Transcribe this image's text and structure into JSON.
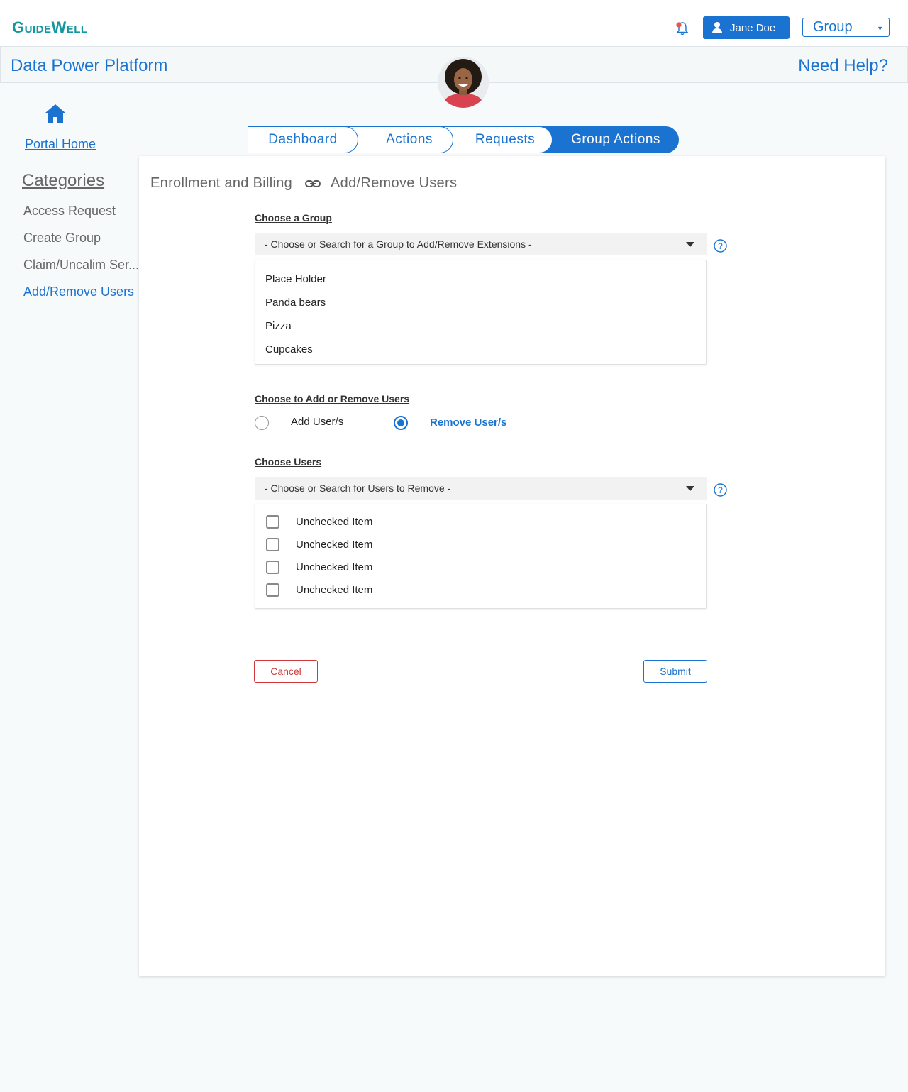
{
  "header": {
    "logo": "GuideWell",
    "user_name": "Jane Doe",
    "group_select": "Group"
  },
  "platform": {
    "title": "Data Power Platform",
    "help": "Need Help?"
  },
  "sidebar": {
    "home_label": "Portal Home",
    "categories_title": "Categories",
    "items": [
      {
        "label": "Access Request"
      },
      {
        "label": "Create Group"
      },
      {
        "label": "Claim/Uncalim Ser..."
      },
      {
        "label": "Add/Remove Users"
      }
    ]
  },
  "tabs": [
    {
      "label": "Dashboard"
    },
    {
      "label": "Actions"
    },
    {
      "label": "Requests"
    },
    {
      "label": "Group Actions"
    }
  ],
  "breadcrumb": {
    "parent": "Enrollment and Billing",
    "current": "Add/Remove Users"
  },
  "group_section": {
    "label": "Choose a Group",
    "placeholder": "- Choose or Search for a Group to Add/Remove Extensions -",
    "options": [
      "Place Holder",
      "Panda bears",
      "Pizza",
      "Cupcakes"
    ]
  },
  "mode_section": {
    "label": "Choose to  Add or Remove Users",
    "add_label": "Add User/s",
    "remove_label": "Remove User/s",
    "selected": "remove"
  },
  "users_section": {
    "label": "Choose Users",
    "placeholder": "- Choose or Search for Users to Remove -",
    "items": [
      "Unchecked Item",
      "Unchecked Item",
      "Unchecked Item",
      "Unchecked Item"
    ]
  },
  "actions": {
    "cancel": "Cancel",
    "submit": "Submit"
  },
  "colors": {
    "brand_teal": "#13969e",
    "primary_blue": "#1a73d1",
    "danger_red": "#d0393b"
  }
}
